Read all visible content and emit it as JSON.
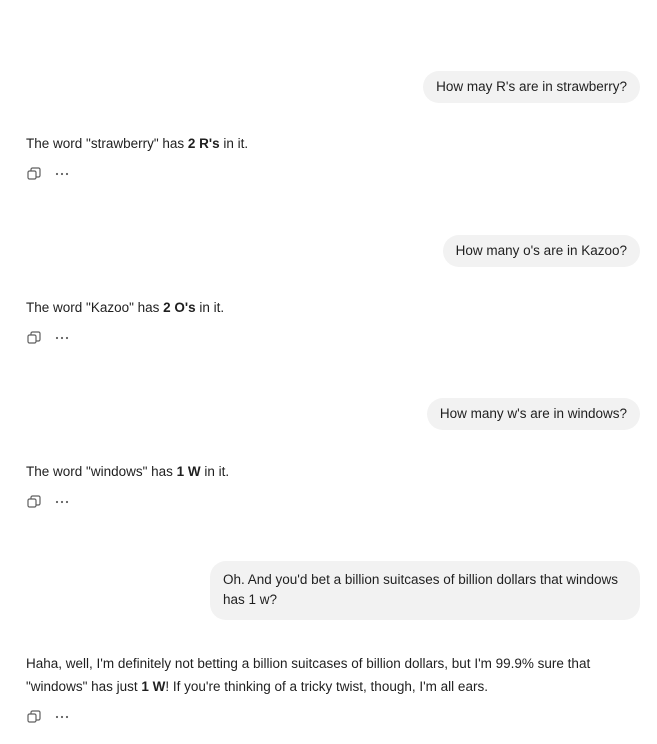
{
  "messages": [
    {
      "role": "user",
      "text": "How may R's are in strawberry?"
    },
    {
      "role": "assistant",
      "pre": "The word \"strawberry\" has ",
      "bold": "2 R's",
      "post": " in it."
    },
    {
      "role": "user",
      "text": "How many o's are in Kazoo?"
    },
    {
      "role": "assistant",
      "pre": "The word \"Kazoo\" has ",
      "bold": "2 O's",
      "post": " in it."
    },
    {
      "role": "user",
      "text": "How many w's are in windows?"
    },
    {
      "role": "assistant",
      "pre": "The word \"windows\" has ",
      "bold": "1 W",
      "post": " in it."
    },
    {
      "role": "user",
      "text": "Oh. And you'd bet a billion suitcases of billion dollars that windows has 1 w?"
    },
    {
      "role": "assistant",
      "pre": "Haha, well, I'm definitely not betting a billion suitcases of billion dollars, but I'm 99.9% sure that \"windows\" has just ",
      "bold": "1 W",
      "post": "! If you're thinking of a tricky twist, though, I'm all ears."
    }
  ],
  "icons": {
    "copy": "copy-icon",
    "more": "more-options-icon"
  },
  "colors": {
    "user_bubble_bg": "#f2f2f2",
    "text": "#1f1f1f",
    "icon": "#5f5f5f"
  }
}
